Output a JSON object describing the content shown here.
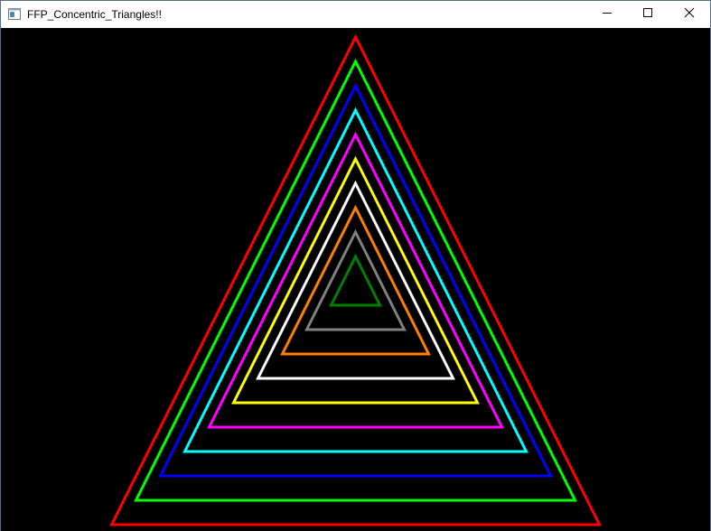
{
  "window": {
    "title": "FFP_Concentric_Triangles!!",
    "icons": {
      "app": "window-app-icon",
      "minimize": "minimize-icon",
      "maximize": "maximize-icon",
      "close": "close-icon"
    }
  },
  "canvas": {
    "background": "#000000",
    "triangle_colors": [
      "#ff0000",
      "#00ff00",
      "#0000ff",
      "#00ffff",
      "#ff00ff",
      "#ffff00",
      "#ffffff",
      "#ff7f00",
      "#808080",
      "#008000"
    ]
  }
}
